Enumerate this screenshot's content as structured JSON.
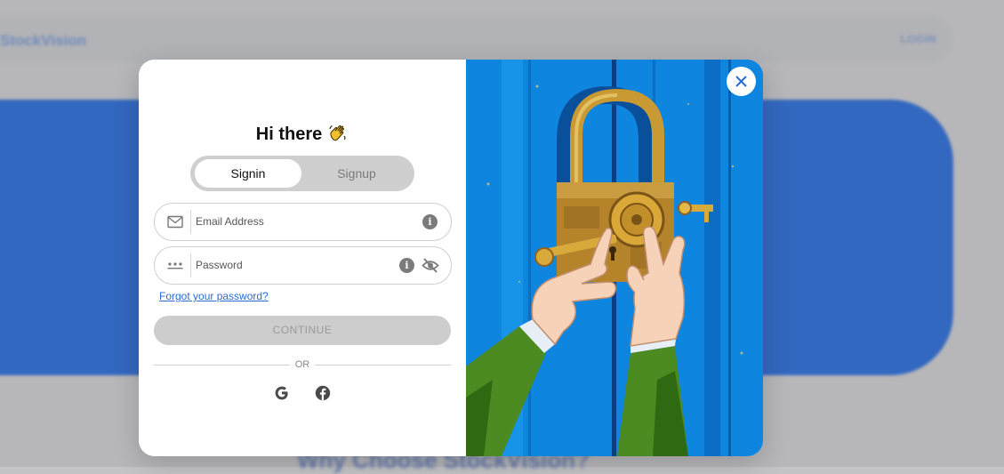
{
  "background": {
    "logo_text": "StockVision",
    "login_text": "LOGIN",
    "heading": "Why Choose StockVision?"
  },
  "modal": {
    "greeting": "Hi there",
    "greeting_emoji": "waving-hand",
    "tabs": [
      {
        "label": "Signin",
        "active": true
      },
      {
        "label": "Signup",
        "active": false
      }
    ],
    "email": {
      "placeholder": "Email Address",
      "value": ""
    },
    "password": {
      "placeholder": "Password",
      "value": ""
    },
    "info_glyph": "i",
    "forgot_label": "Forgot your password?",
    "continue_label": "CONTINUE",
    "or_label": "OR",
    "social": [
      "google-icon",
      "facebook-icon"
    ],
    "illustration": "hands-unlocking-padlock-on-blue-door",
    "close_icon": "close-icon"
  },
  "colors": {
    "accent": "#2a6bd4",
    "hero_blue": "#2465cf",
    "art_blue": "#0e86e0",
    "button_disabled": "#cdcdcd"
  }
}
